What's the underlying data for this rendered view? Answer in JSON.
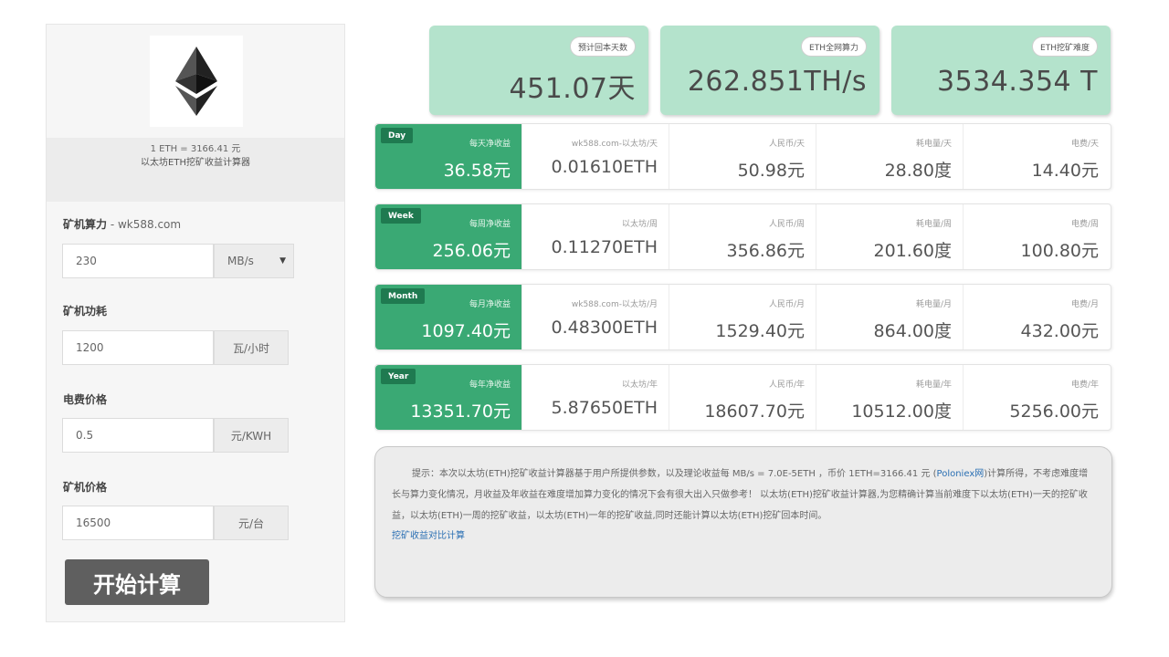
{
  "left": {
    "rate_line": "1 ETH = 3166.41 元",
    "calc_title": "以太坊ETH挖矿收益计算器",
    "hashrate_label": "矿机算力",
    "hashrate_site": " - wk588.com",
    "hashrate_value": "230",
    "hashrate_unit": "MB/s",
    "power_label": "矿机功耗",
    "power_value": "1200",
    "power_unit": "瓦/小时",
    "elec_label": "电费价格",
    "elec_value": "0.5",
    "elec_unit": "元/KWH",
    "price_label": "矿机价格",
    "price_value": "16500",
    "price_unit": "元/台",
    "start_button": "开始计算"
  },
  "summary": [
    {
      "badge": "预计回本天数",
      "value": "451.07天"
    },
    {
      "badge": "ETH全网算力",
      "value": "262.851TH/s"
    },
    {
      "badge": "ETH挖矿难度",
      "value": "3534.354 T"
    }
  ],
  "rows": [
    {
      "tag": "Day",
      "head_label": "每天净收益",
      "head_value": "36.58元",
      "cells": [
        {
          "label": "wk588.com-以太坊/天",
          "value": "0.01610ETH"
        },
        {
          "label": "人民币/天",
          "value": "50.98元"
        },
        {
          "label": "耗电量/天",
          "value": "28.80度"
        },
        {
          "label": "电费/天",
          "value": "14.40元"
        }
      ]
    },
    {
      "tag": "Week",
      "head_label": "每周净收益",
      "head_value": "256.06元",
      "cells": [
        {
          "label": "以太坊/周",
          "value": "0.11270ETH"
        },
        {
          "label": "人民币/周",
          "value": "356.86元"
        },
        {
          "label": "耗电量/周",
          "value": "201.60度"
        },
        {
          "label": "电费/周",
          "value": "100.80元"
        }
      ]
    },
    {
      "tag": "Month",
      "head_label": "每月净收益",
      "head_value": "1097.40元",
      "cells": [
        {
          "label": "wk588.com-以太坊/月",
          "value": "0.48300ETH"
        },
        {
          "label": "人民币/月",
          "value": "1529.40元"
        },
        {
          "label": "耗电量/月",
          "value": "864.00度"
        },
        {
          "label": "电费/月",
          "value": "432.00元"
        }
      ]
    },
    {
      "tag": "Year",
      "head_label": "每年净收益",
      "head_value": "13351.70元",
      "cells": [
        {
          "label": "以太坊/年",
          "value": "5.87650ETH"
        },
        {
          "label": "人民币/年",
          "value": "18607.70元"
        },
        {
          "label": "耗电量/年",
          "value": "10512.00度"
        },
        {
          "label": "电费/年",
          "value": "5256.00元"
        }
      ]
    }
  ],
  "note": {
    "text_part1": "提示：本次以太坊(ETH)挖矿收益计算器基于用户所提供参数，以及理论收益每 MB/s = 7.0E-5ETH ，币价 1ETH=3166.41 元 (",
    "text_link": "Poloniex网",
    "text_part2": ")计算所得，不考虑难度增长与算力变化情况，月收益及年收益在难度增加算力变化的情况下会有很大出入只做参考！ 以太坊(ETH)挖矿收益计算器,为您精确计算当前难度下以太坊(ETH)一天的挖矿收益，以太坊(ETH)一周的挖矿收益，以太坊(ETH)一年的挖矿收益,同时还能计算以太坊(ETH)挖矿回本时间。",
    "link": "挖矿收益对比计算"
  },
  "colors": {
    "accent": "#3aa974",
    "accent_dark": "#1f7a50",
    "card_bg": "#b4e3cc",
    "button_bg": "#5f5f5f"
  },
  "icons": {
    "logo": "ethereum-logo"
  }
}
